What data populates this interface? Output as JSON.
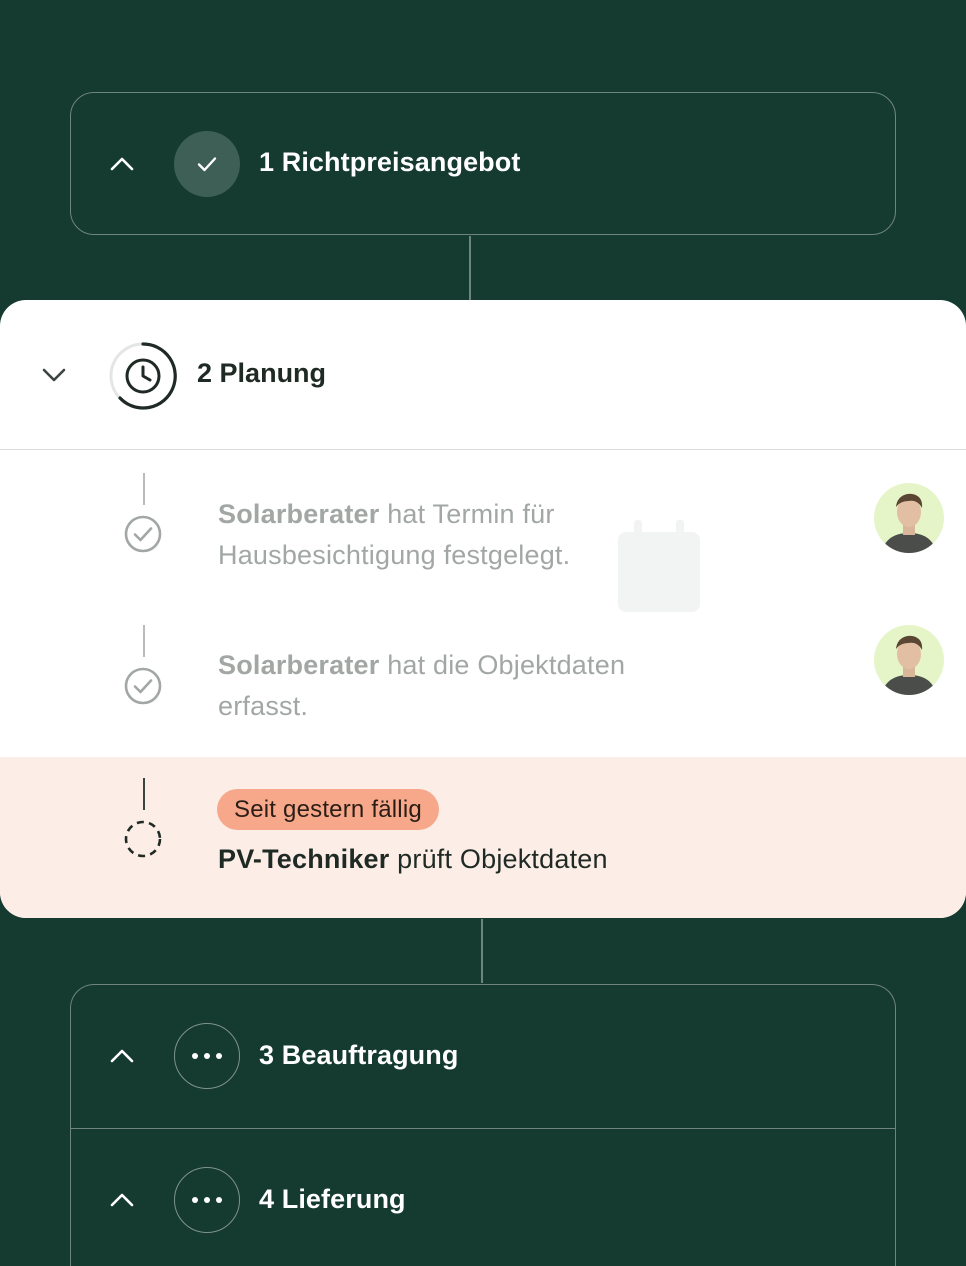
{
  "stages": [
    {
      "number": "1",
      "title": "Richtpreisangebot",
      "status": "done"
    },
    {
      "number": "2",
      "title": "Planung",
      "status": "in-progress"
    },
    {
      "number": "3",
      "title": "Beauftragung",
      "status": "pending"
    },
    {
      "number": "4",
      "title": "Lieferung",
      "status": "pending"
    }
  ],
  "planung_tasks": [
    {
      "actor": "Solarberater",
      "text": "hat Termin für",
      "text2": "Hausbesichtigung festgelegt.",
      "status": "done",
      "avatar": "avatar-solarberater"
    },
    {
      "actor": "Solarberater",
      "text": "hat die Objektdaten",
      "text2": "erfasst.",
      "status": "done",
      "avatar": "avatar-solarberater"
    }
  ],
  "due_task": {
    "badge": "Seit gestern fällig",
    "actor": "PV-Techniker",
    "text": "prüft Objektdaten"
  },
  "colors": {
    "background": "#153a2f",
    "done_circle": "#3d5f55",
    "due_background": "#fdede7",
    "badge": "#f7a88a"
  },
  "icons": [
    "chevron-up-icon",
    "chevron-down-icon",
    "check-icon",
    "clock-icon",
    "check-circle-icon",
    "dashed-circle-icon",
    "more-dots-icon"
  ]
}
